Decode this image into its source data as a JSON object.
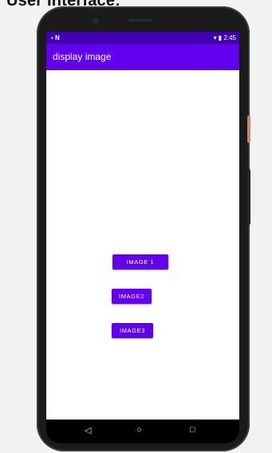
{
  "caption": "User Interface:",
  "status_bar": {
    "left_icons": "▪ N",
    "right_text": "▾ ▮ 2:45"
  },
  "app_bar": {
    "title": "display image"
  },
  "buttons": {
    "image1": "IMAGE 1",
    "image2": "IMAGE2",
    "image3": "IMAGE3"
  },
  "nav": {
    "back": "◁",
    "home": "○",
    "recents": "□"
  }
}
